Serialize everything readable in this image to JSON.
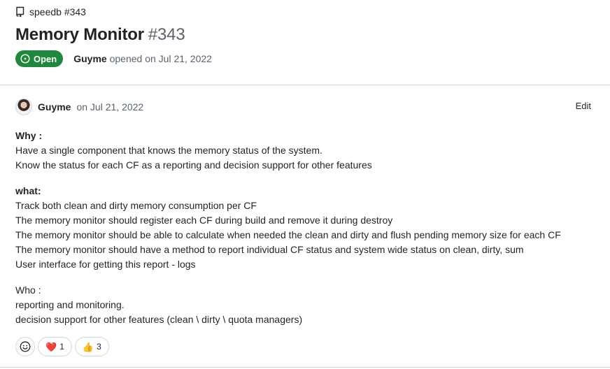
{
  "repo": {
    "label": "speedb #343",
    "icon": "repo-icon"
  },
  "issue": {
    "title": "Memory Monitor",
    "number": "#343",
    "state": "Open",
    "author": "Guyme",
    "opened_text": "opened on Jul 21, 2022"
  },
  "comment": {
    "author": "Guyme",
    "date": "on Jul 21, 2022",
    "edit_label": "Edit",
    "lines": [
      "Why :",
      "Have a single component that knows the memory status of the system.",
      "Know the status for each CF as a reporting and decision support for other features",
      "what:",
      "Track both clean and dirty memory consumption per CF",
      "The memory monitor should register each CF during build and remove it during destroy",
      "The memory monitor should be able to calculate when needed the clean and dirty and flush pending memory size for each CF",
      "The memory monitor should have a method to report individual CF status and system wide status on clean, dirty, sum",
      "User interface for getting this report - logs",
      "Who :",
      "reporting and monitoring.",
      "decision support for other features (clean \\ dirty \\ quota managers)"
    ]
  },
  "reactions": [
    {
      "emoji": "❤️",
      "count": "1",
      "icon": "heart-icon"
    },
    {
      "emoji": "👍",
      "count": "3",
      "icon": "thumbs-up-icon"
    }
  ],
  "colors": {
    "open_badge": "#1f883d",
    "muted": "#59636e",
    "border": "#d1d9e0"
  }
}
